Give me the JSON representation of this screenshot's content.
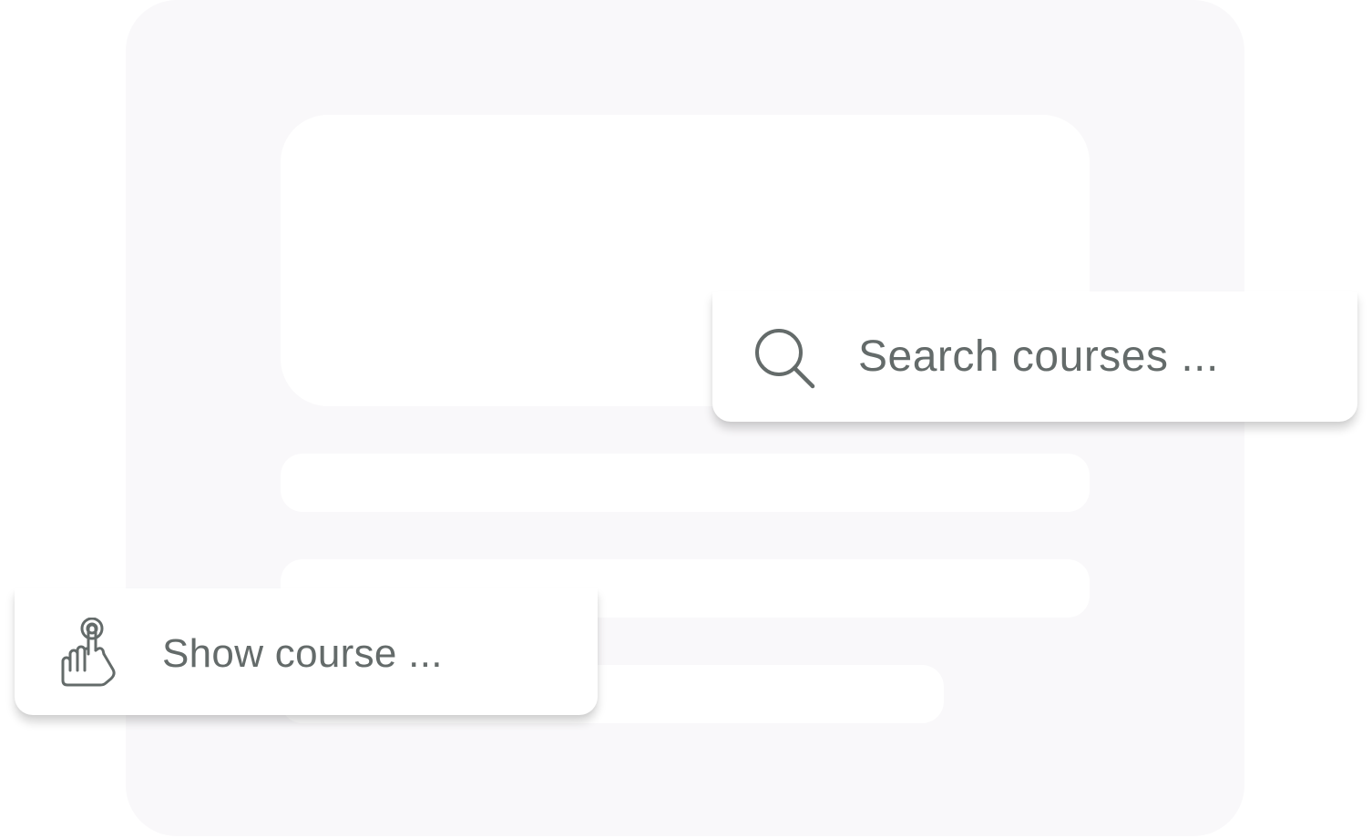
{
  "search_card": {
    "icon": "search-icon",
    "label": "Search courses ..."
  },
  "show_card": {
    "icon": "pointing-hand-icon",
    "label": "Show course ..."
  },
  "colors": {
    "background_panel": "#f9f8fa",
    "placeholder_block": "#ffffff",
    "text": "#646b6a",
    "icon": "#646b6a"
  }
}
